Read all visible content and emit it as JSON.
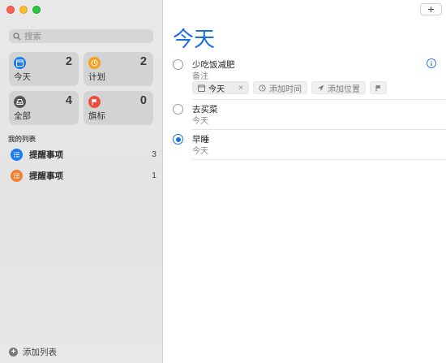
{
  "sidebar": {
    "search_placeholder": "搜索",
    "cards": [
      {
        "label": "今天",
        "count": "2",
        "color": "#1a7cf0",
        "icon": "calendar-icon"
      },
      {
        "label": "计划",
        "count": "2",
        "color": "#f59f1d",
        "icon": "clock-icon"
      },
      {
        "label": "全部",
        "count": "4",
        "color": "#555555",
        "icon": "tray-icon"
      },
      {
        "label": "旗标",
        "count": "0",
        "color": "#eb4d3d",
        "icon": "flag-icon"
      }
    ],
    "section_title": "我的列表",
    "lists": [
      {
        "name": "提醒事项",
        "count": "3",
        "color": "#1a7cf0"
      },
      {
        "name": "提醒事项",
        "count": "1",
        "color": "#f3802e"
      }
    ],
    "add_list_label": "添加列表"
  },
  "main": {
    "add_button": "+",
    "title": "今天",
    "tasks": [
      {
        "title": "少吃饭减肥",
        "note": "备注"
      },
      {
        "title": "去买菜",
        "note": "今天"
      },
      {
        "title": "早睡",
        "note": "今天"
      }
    ],
    "chips": {
      "date_label": "今天",
      "date_clear": "×",
      "time_label": "添加时间",
      "location_label": "添加位置"
    }
  }
}
